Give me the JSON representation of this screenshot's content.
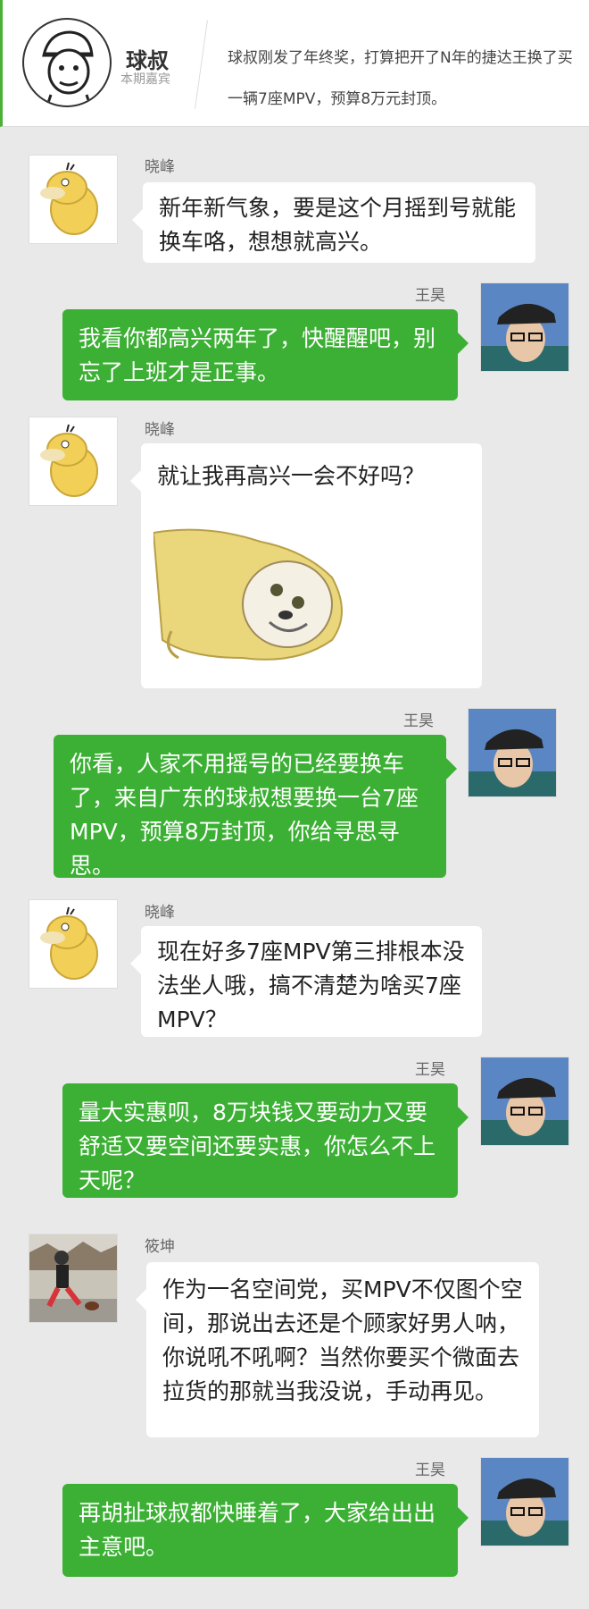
{
  "header": {
    "guest_name": "球叔",
    "guest_role": "本期嘉宾",
    "intro": "球叔刚发了年终奖，打算把开了N年的捷达王换了买一辆7座MPV，预算8万元封顶。"
  },
  "messages": [
    {
      "side": "left",
      "name": "晓峰",
      "avatar": "psyduck-avatar",
      "text": "新年新气象，要是这个月摇到号就能换车咯，想想就高兴。"
    },
    {
      "side": "right",
      "name": "王昊",
      "avatar": "user-photo-avatar",
      "text": "我看你都高兴两年了，快醒醒吧，别忘了上班才是正事。"
    },
    {
      "side": "left",
      "name": "晓峰",
      "avatar": "psyduck-avatar",
      "text": "就让我再高兴一会不好吗？",
      "sticker": "doge-sticker"
    },
    {
      "side": "right",
      "name": "王昊",
      "avatar": "user-photo-avatar",
      "text": "你看，人家不用摇号的已经要换车了，来自广东的球叔想要换一台7座MPV，预算8万封顶，你给寻思寻思。"
    },
    {
      "side": "left",
      "name": "晓峰",
      "avatar": "psyduck-avatar",
      "text": "现在好多7座MPV第三排根本没法坐人哦，搞不清楚为啥买7座MPV？"
    },
    {
      "side": "right",
      "name": "王昊",
      "avatar": "user-photo-avatar",
      "text": "量大实惠呗，8万块钱又要动力又要舒适又要空间还要实惠，你怎么不上天呢？"
    },
    {
      "side": "left",
      "name": "筱坤",
      "avatar": "runner-photo-avatar",
      "text": "作为一名空间党，买MPV不仅图个空间，那说出去还是个顾家好男人呐，你说吼不吼啊？当然你要买个微面去拉货的那就当我没说，手动再见。"
    },
    {
      "side": "right",
      "name": "王昊",
      "avatar": "user-photo-avatar",
      "text": "再胡扯球叔都快睡着了，大家给出出主意吧。"
    }
  ],
  "colors": {
    "accent": "#3cb034",
    "background": "#e9e9e9",
    "bubble_white": "#ffffff"
  }
}
